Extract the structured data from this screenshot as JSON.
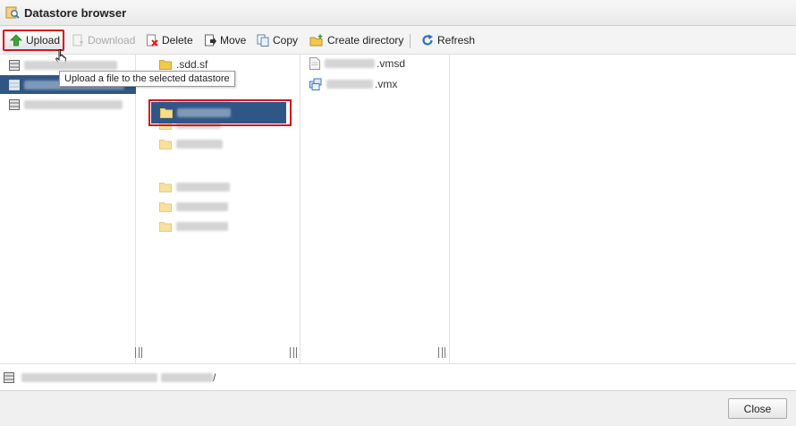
{
  "window": {
    "title": "Datastore browser"
  },
  "toolbar": {
    "upload_label": "Upload",
    "download_label": "Download",
    "delete_label": "Delete",
    "move_label": "Move",
    "copy_label": "Copy",
    "create_directory_label": "Create directory",
    "refresh_label": "Refresh"
  },
  "tooltip": {
    "text": "Upload a file to the selected datastore"
  },
  "datastores": [
    {
      "name": "",
      "selected": false
    },
    {
      "name": "",
      "selected": true
    },
    {
      "name": "",
      "selected": false
    }
  ],
  "directories": [
    {
      "name": ".sdd.sf",
      "selected": false
    },
    {
      "name": "",
      "selected": false
    },
    {
      "name": "",
      "selected": false
    },
    {
      "name": "",
      "selected": false
    },
    {
      "name": "",
      "selected": false
    },
    {
      "name": "",
      "selected": true
    },
    {
      "name": "",
      "selected": false
    },
    {
      "name": "",
      "selected": false
    },
    {
      "name": "",
      "selected": false
    }
  ],
  "files": [
    {
      "extension": ".vmsd",
      "icon": "file-icon"
    },
    {
      "extension": ".vmx",
      "icon": "vm-config-icon"
    }
  ],
  "status": {
    "path_suffix": "/"
  },
  "footer": {
    "close_label": "Close"
  },
  "colors": {
    "selection": "#2f5686",
    "highlight_border": "#d9141a",
    "folder": "#f2c94c"
  }
}
